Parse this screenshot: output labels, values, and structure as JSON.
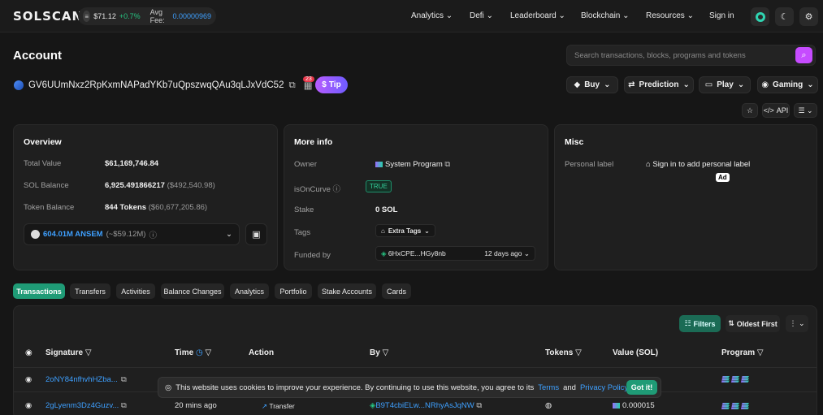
{
  "brand": {
    "logo": "SOLSCAN"
  },
  "price": {
    "value": "$71.12",
    "change": "+0.7%",
    "fee_label": "Avg Fee:",
    "fee_value": "0.00000969"
  },
  "nav": {
    "items": [
      "Analytics",
      "Defi",
      "Leaderboard",
      "Blockchain",
      "Resources"
    ],
    "sign_in": "Sign in"
  },
  "page": {
    "title": "Account"
  },
  "search": {
    "placeholder": "Search transactions, blocks, programs and tokens"
  },
  "account": {
    "address": "GV6UUmNxz2RpKxmNAPadYKb7uQpszwqQAu3qLJxVdC52",
    "notif_count": "23",
    "tip_label": "Tip"
  },
  "actions": {
    "buy": "Buy",
    "prediction": "Prediction",
    "play": "Play",
    "gaming": "Gaming",
    "api": "API"
  },
  "overview": {
    "title": "Overview",
    "total_value_label": "Total Value",
    "total_value": "$61,169,746.84",
    "sol_balance_label": "SOL Balance",
    "sol_balance": "6,925.491866217",
    "sol_balance_usd": "($492,540.98)",
    "token_balance_label": "Token Balance",
    "token_balance": "844 Tokens",
    "token_balance_usd": "($60,677,205.86)",
    "token_select": "604.01M ANSEM",
    "token_select_usd": "(~$59.12M)"
  },
  "moreinfo": {
    "title": "More info",
    "owner_label": "Owner",
    "owner": "System Program",
    "curve_label": "isOnCurve",
    "curve": "TRUE",
    "stake_label": "Stake",
    "stake": "0 SOL",
    "tags_label": "Tags",
    "tags": "Extra Tags",
    "funded_label": "Funded by",
    "funded_addr": "6HxCPE...HGy8nb",
    "funded_time": "12 days ago"
  },
  "misc": {
    "title": "Misc",
    "label": "Personal label",
    "link": "Sign in to add personal label",
    "ad": "Ad"
  },
  "tabs": [
    "Transactions",
    "Transfers",
    "Activities",
    "Balance Changes",
    "Analytics",
    "Portfolio",
    "Stake Accounts",
    "Cards"
  ],
  "table": {
    "filters": "Filters",
    "sort": "Oldest First",
    "headers": {
      "signature": "Signature",
      "time": "Time",
      "action": "Action",
      "by": "By",
      "tokens": "Tokens",
      "value": "Value (SOL)",
      "program": "Program"
    },
    "rows": [
      {
        "signature": "2oNY84nfhvhHZba...",
        "time": "",
        "action": "",
        "by": "",
        "value": ""
      },
      {
        "signature": "2gLyenm3Dz4Guzv...",
        "time": "20 mins ago",
        "action": "Transfer",
        "by": "B9T4cbiELw...NRhyAsJqNW",
        "value": "0.000015"
      }
    ]
  },
  "cookie": {
    "text": "This website uses cookies to improve your experience. By continuing to use this website, you agree to its",
    "terms": "Terms",
    "and": "and",
    "privacy": "Privacy Policy",
    "button": "Got it!"
  }
}
